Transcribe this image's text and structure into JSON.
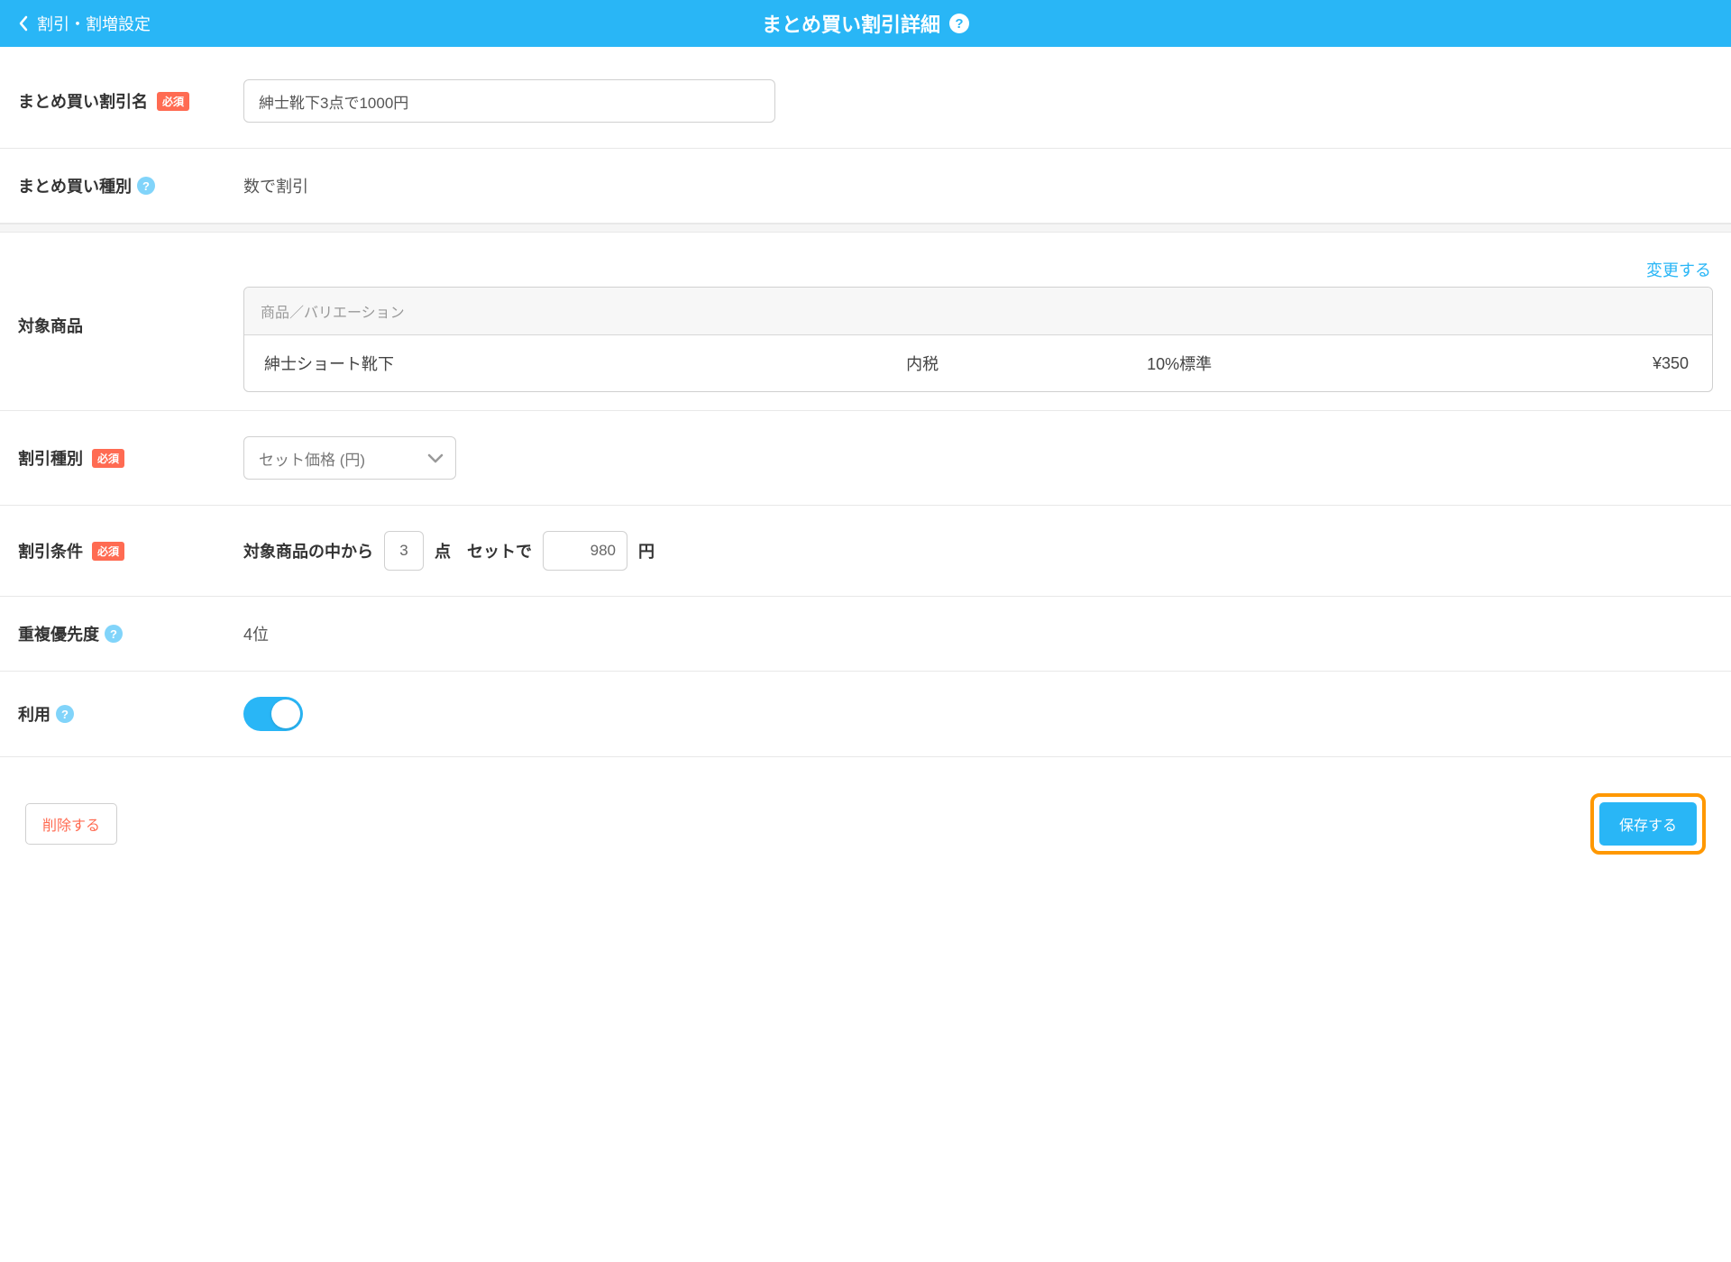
{
  "header": {
    "back_label": "割引・割増設定",
    "title": "まとめ買い割引詳細"
  },
  "fields": {
    "name": {
      "label": "まとめ買い割引名",
      "required_badge": "必須",
      "value": "紳士靴下3点で1000円"
    },
    "type": {
      "label": "まとめ買い種別",
      "value": "数で割引"
    },
    "target": {
      "label": "対象商品",
      "change_link": "変更する",
      "table_header": "商品／バリエーション",
      "rows": [
        {
          "name": "紳士ショート靴下",
          "tax": "内税",
          "rate": "10%標準",
          "price": "¥350"
        }
      ]
    },
    "discount_type": {
      "label": "割引種別",
      "required_badge": "必須",
      "selected": "セット価格 (円)"
    },
    "condition": {
      "label": "割引条件",
      "required_badge": "必須",
      "text_before": "対象商品の中から",
      "qty": "3",
      "text_qty_unit": "点",
      "text_set": "セットで",
      "price": "980",
      "text_price_unit": "円"
    },
    "priority": {
      "label": "重複優先度",
      "value": "4位"
    },
    "usage": {
      "label": "利用",
      "enabled": true
    }
  },
  "footer": {
    "delete": "削除する",
    "save": "保存する"
  }
}
